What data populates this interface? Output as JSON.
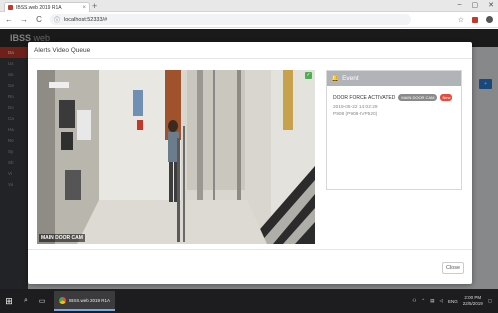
{
  "browser": {
    "tab_title": "IBSS.web 2019 R1A",
    "tab_close": "×",
    "new_tab": "+",
    "win_controls": {
      "minimize": "–",
      "maximize": "▢",
      "close": "✕"
    },
    "url": "localhost:52333/#",
    "icons": {
      "back": "←",
      "forward": "→",
      "reload": "C",
      "info": "ⓘ",
      "star": "☆"
    }
  },
  "app": {
    "logo": "IBSS",
    "logo_sub": "web",
    "sidebar_items": [
      "Da",
      "Us",
      "Se",
      "Ge",
      "Ro",
      "Do",
      "Ca",
      "Ha",
      "Re",
      "Sy",
      "Sh",
      "Vi",
      "Vo"
    ],
    "button": "+"
  },
  "modal": {
    "title": "Alerts Video Queue",
    "camera_label": "MAIN DOOR CAM",
    "camera_status": "✓",
    "event": {
      "header": "Event",
      "title": "DOOR FORCE ACTIVATED",
      "camera_badge": "MAIN DOOR CAM",
      "new_badge": "New",
      "timestamp": "2019-05-22 14:02:29",
      "device": "P908 (P908-IVP520)"
    },
    "close_label": "Close"
  },
  "taskbar": {
    "app_label": "IBSS.web 2019 R1A",
    "language": "ENG",
    "time": "2:00 PM",
    "date": "22/5/2019"
  }
}
